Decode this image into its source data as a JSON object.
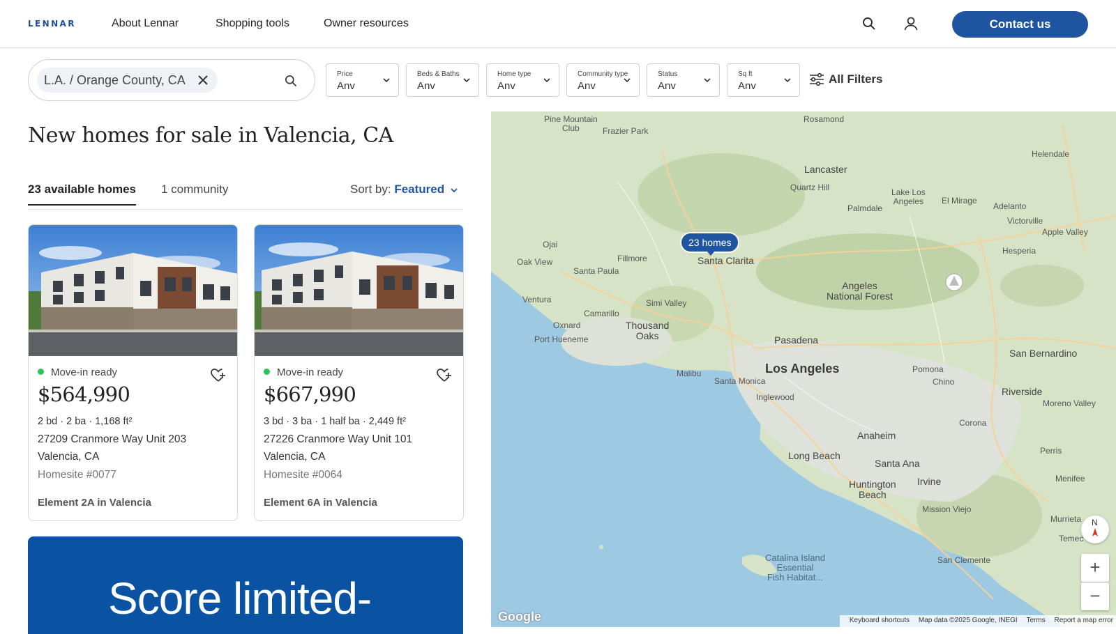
{
  "header": {
    "logo": "LENNAR",
    "nav": [
      "About Lennar",
      "Shopping tools",
      "Owner resources"
    ],
    "contact_label": "Contact us"
  },
  "search": {
    "chip": "L.A. / Orange County, CA"
  },
  "filters": [
    {
      "label": "Price",
      "value": "Anv"
    },
    {
      "label": "Beds & Baths",
      "value": "Anv"
    },
    {
      "label": "Home type",
      "value": "Anv"
    },
    {
      "label": "Community type",
      "value": "Anv"
    },
    {
      "label": "Status",
      "value": "Anv"
    },
    {
      "label": "Sq ft",
      "value": "Anv"
    }
  ],
  "all_filters_label": "All Filters",
  "page_title": "New homes for sale in Valencia, CA",
  "tabs": {
    "homes": "23 available homes",
    "community": "1 community"
  },
  "sort": {
    "prefix": "Sort by:",
    "value": "Featured"
  },
  "cards": [
    {
      "status": "Move-in ready",
      "price": "$564,990",
      "specs": "2 bd · 2 ba · 1,168 ft²",
      "address1": "27209 Cranmore Way Unit 203",
      "address2": "Valencia, CA",
      "homesite": "Homesite #0077",
      "community": "Element 2A in Valencia"
    },
    {
      "status": "Move-in ready",
      "price": "$667,990",
      "specs": "3 bd · 3 ba · 1 half ba · 2,449 ft²",
      "address1": "27226 Cranmore Way Unit 101",
      "address2": "Valencia, CA",
      "homesite": "Homesite #0064",
      "community": "Element 6A in Valencia"
    }
  ],
  "promo_text": "Score limited-",
  "map": {
    "pin": "23 homes",
    "labels": {
      "pine_mountain": "Pine Mountain\nClub",
      "frazier_park": "Frazier Park",
      "rosamond": "Rosamond",
      "lancaster": "Lancaster",
      "quartz_hill": "Quartz Hill",
      "palmdale": "Palmdale",
      "lake_los_angeles": "Lake Los\nAngeles",
      "el_mirage": "El Mirage",
      "adelanto": "Adelanto",
      "victorville": "Victorville",
      "apple_valley": "Apple Valley",
      "helendale": "Helendale",
      "hesperia": "Hesperia",
      "ojai": "Ojai",
      "oak_view": "Oak View",
      "fillmore": "Fillmore",
      "santa_paula": "Santa Paula",
      "santa_clarita": "Santa Clarita",
      "ventura": "Ventura",
      "camarillo": "Camarillo",
      "oxnard": "Oxnard",
      "simi_valley": "Simi Valley",
      "thousand_oaks": "Thousand\nOaks",
      "port_hueneme": "Port Hueneme",
      "angeles_forest": "Angeles\nNational Forest",
      "pasadena": "Pasadena",
      "san_bernardino": "San Bernardino",
      "malibu": "Malibu",
      "los_angeles": "Los Angeles",
      "santa_monica": "Santa Monica",
      "inglewood": "Inglewood",
      "pomona": "Pomona",
      "chino": "Chino",
      "riverside": "Riverside",
      "moreno_valley": "Moreno Valley",
      "anaheim": "Anaheim",
      "corona": "Corona",
      "long_beach": "Long Beach",
      "santa_ana": "Santa Ana",
      "irvine": "Irvine",
      "huntington_beach": "Huntington\nBeach",
      "perris": "Perris",
      "menifee": "Menifee",
      "mission_viejo": "Mission Viejo",
      "murrieta": "Murrieta",
      "temecula": "Temec",
      "catalina": "Catalina Island\nEssential\nFish Habitat...",
      "san_clemente": "San Clemente"
    },
    "compass": "N",
    "zoom_in": "+",
    "zoom_out": "−",
    "google": "Google",
    "keyboard": "Keyboard shortcuts",
    "map_data": "Map data ©2025 Google, INEGI",
    "terms": "Terms",
    "report": "Report a map error"
  }
}
